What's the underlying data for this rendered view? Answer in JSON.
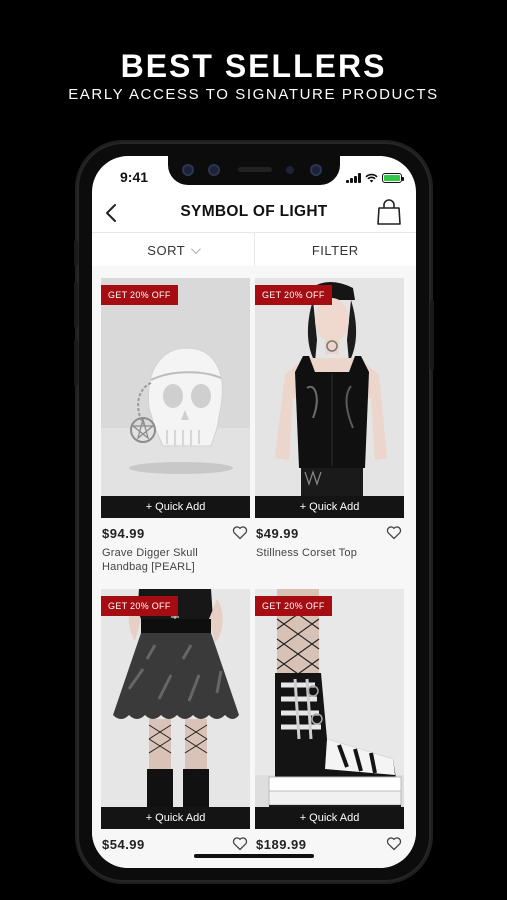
{
  "promo": {
    "title": "BEST SELLERS",
    "subtitle": "EARLY ACCESS TO SIGNATURE PRODUCTS"
  },
  "status_bar": {
    "time": "9:41"
  },
  "header": {
    "title": "SYMBOL OF LIGHT",
    "back_icon": "chevron-left-icon",
    "bag_icon": "shopping-bag-icon"
  },
  "toolbar": {
    "sort_label": "SORT",
    "filter_label": "FILTER"
  },
  "products": [
    {
      "badge": "GET 20% OFF",
      "quick_add": "+ Quick Add",
      "price": "$94.99",
      "name": "Grave Digger Skull Handbag [PEARL]"
    },
    {
      "badge": "GET 20% OFF",
      "quick_add": "+ Quick Add",
      "price": "$49.99",
      "name": "Stillness Corset Top"
    },
    {
      "badge": "GET 20% OFF",
      "quick_add": "+ Quick Add",
      "price": "$54.99",
      "name": ""
    },
    {
      "badge": "GET 20% OFF",
      "quick_add": "+ Quick Add",
      "price": "$189.99",
      "name": ""
    }
  ],
  "colors": {
    "badge": "#a50d12",
    "quick_add_bg": "#141414",
    "battery": "#33c748"
  }
}
